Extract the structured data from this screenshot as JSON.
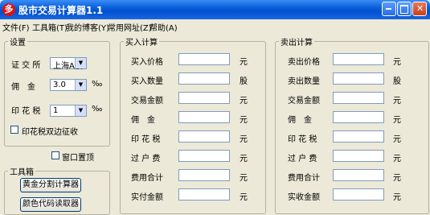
{
  "window": {
    "title": "股市交易计算器1.1",
    "app_icon_glyph": "多"
  },
  "menu": [
    "文件(F)",
    "工具箱(T)",
    "我的博客(Y)",
    "常用网址(Z)",
    "帮助(A)"
  ],
  "settings": {
    "legend": "设置",
    "exchange_label": "证 交 所",
    "exchange_value": "上海A股",
    "commission_label": "佣　金",
    "commission_value": "3.0",
    "commission_unit": "‰",
    "stamp_label": "印 花 税",
    "stamp_value": "1",
    "stamp_unit": "‰",
    "bilateral_label": "印花税双边征收",
    "topmost_label": "窗口置顶"
  },
  "toolbox": {
    "legend": "工具箱",
    "buttons": [
      "黄金分割计算器",
      "颜色代码读取器"
    ]
  },
  "buy": {
    "legend": "买入计算",
    "rows": [
      {
        "label": "买入价格",
        "unit": "元"
      },
      {
        "label": "买入数量",
        "unit": "股"
      },
      {
        "label": "交易金额",
        "unit": "元"
      },
      {
        "label": "佣　金",
        "unit": "元"
      },
      {
        "label": "印 花 税",
        "unit": "元"
      },
      {
        "label": "过 户 费",
        "unit": "元"
      },
      {
        "label": "费用合计",
        "unit": "元"
      },
      {
        "label": "实付金额",
        "unit": "元"
      }
    ]
  },
  "sell": {
    "legend": "卖出计算",
    "rows": [
      {
        "label": "卖出价格",
        "unit": "元"
      },
      {
        "label": "卖出数量",
        "unit": "股"
      },
      {
        "label": "交易金额",
        "unit": "元"
      },
      {
        "label": "佣　金",
        "unit": "元"
      },
      {
        "label": "印 花 税",
        "unit": "元"
      },
      {
        "label": "过 户 费",
        "unit": "元"
      },
      {
        "label": "费用合计",
        "unit": "元"
      },
      {
        "label": "实收金额",
        "unit": "元"
      }
    ]
  }
}
